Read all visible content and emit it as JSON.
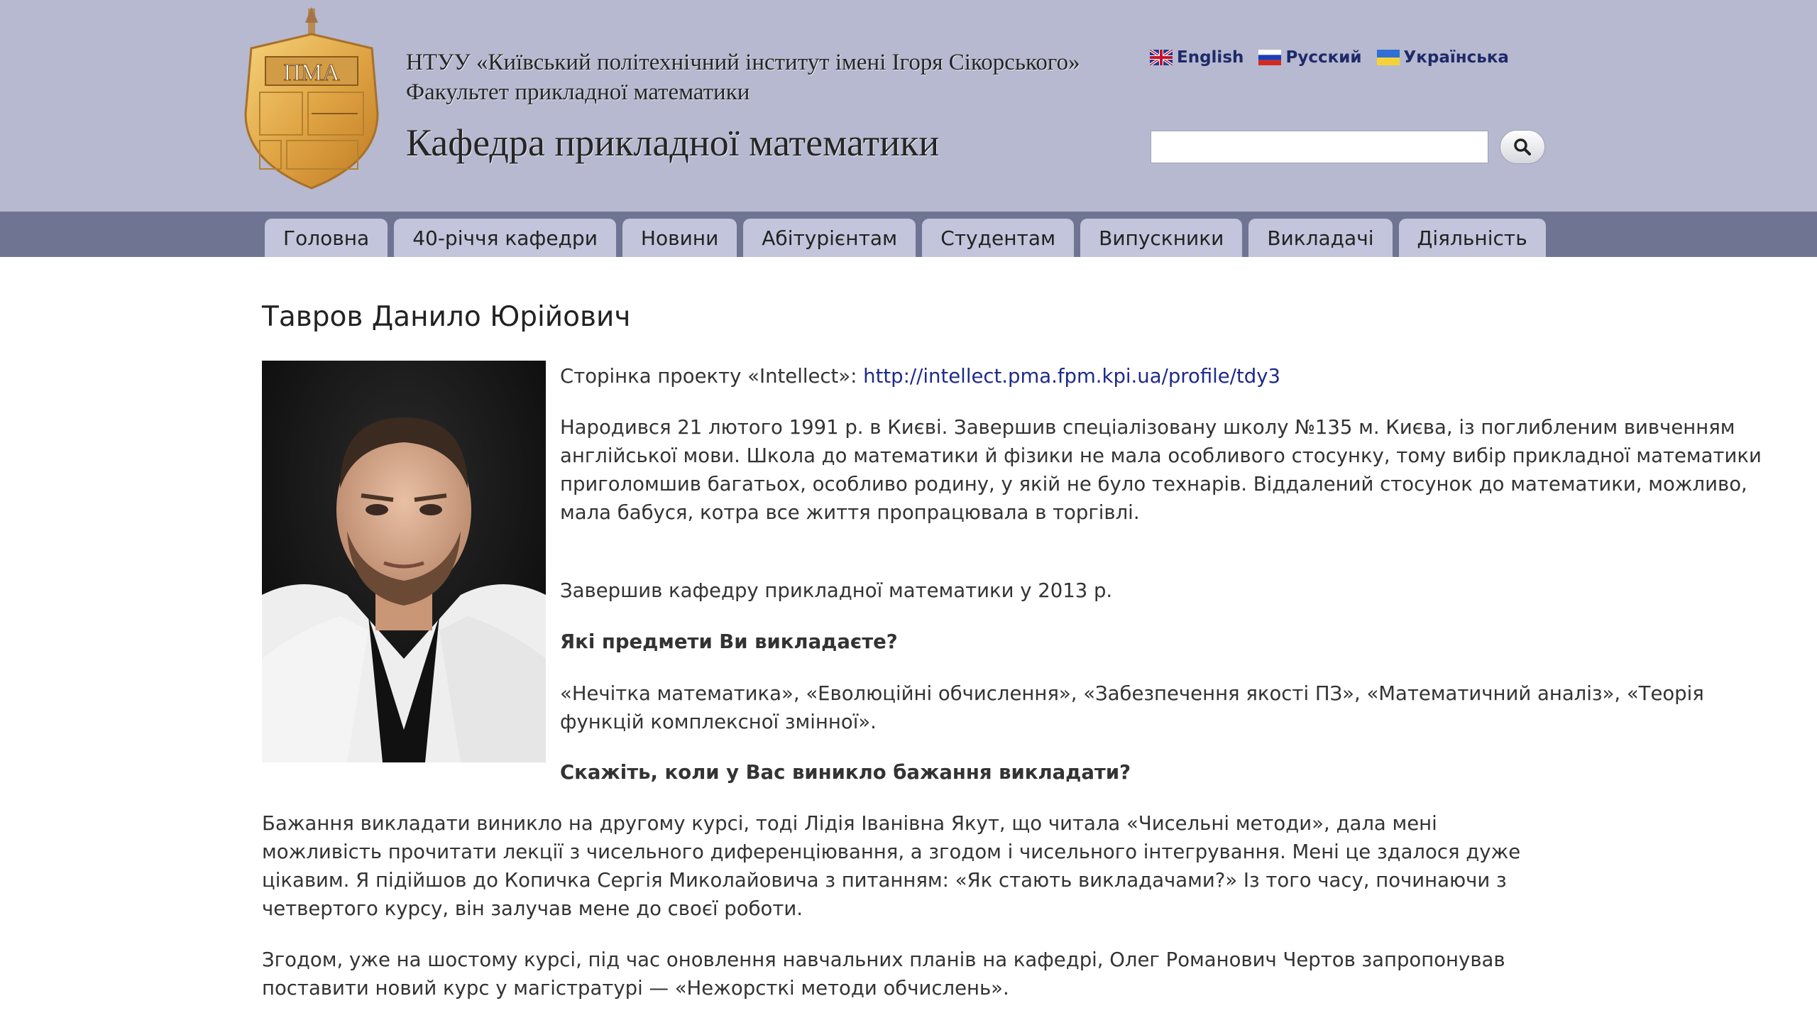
{
  "header": {
    "university": "НТУУ «Київський політехнічний інститут імені Ігоря Сікорського»",
    "faculty": "Факультет прикладної математики",
    "department": "Кафедра прикладної математики",
    "logo": {
      "abbrev": "ПМА",
      "icon": "department-crest-icon"
    },
    "languages": [
      {
        "label": "English",
        "icon": "uk-flag-icon"
      },
      {
        "label": "Русский",
        "icon": "ru-flag-icon"
      },
      {
        "label": "Українська",
        "icon": "ua-flag-icon"
      }
    ],
    "search": {
      "value": "",
      "placeholder": "",
      "icon": "search-icon"
    }
  },
  "nav": {
    "tabs": [
      {
        "label": "Головна"
      },
      {
        "label": "40-річчя кафедри"
      },
      {
        "label": "Новини"
      },
      {
        "label": "Абітурієнтам"
      },
      {
        "label": "Студентам"
      },
      {
        "label": "Випускники"
      },
      {
        "label": "Викладачі"
      },
      {
        "label": "Діяльність"
      }
    ]
  },
  "page": {
    "title": "Тавров Данило Юрійович",
    "intellect_prefix": "Сторінка проекту «Intellect»: ",
    "intellect_link": "http://intellect.pma.fpm.kpi.ua/profile/tdy3",
    "bio_1": "Народився 21 лютого 1991 р. в Києві. Завершив спеціалізовану школу №135 м. Києва, із поглибленим вивченням англійської мови. Школа до математики й фізики не мала особливого стосунку, тому вибір прикладної математики приголомшив багатьох, особливо родину, у якій не було технарів. Віддалений стосунок до математики, можливо, мала бабуся, котра все життя пропрацювала в торгівлі.",
    "bio_2": "Завершив кафедру прикладної математики у 2013 р.",
    "q1": "Які предмети Ви викладаєте?",
    "a1": "«Нечітка математика», «Еволюційні обчислення», «Забезпечення якості ПЗ», «Математичний аналіз», «Теорія функцій комплексної змінної».",
    "q2": "Скажіть, коли у Вас виникло бажання викладати?",
    "a2": "Бажання викладати виникло на другому курсі, тоді Лідія Іванівна Якут, що читала «Чисельні методи», дала мені можливість прочитати лекції з чисельного диференціювання, а згодом і чисельного інтегрування. Мені це здалося дуже цікавим. Я підійшов до Копичка Сергія Миколайовича з питанням: «Як стають викладачами?» Із того часу, починаючи з четвертого курсу, він залучав мене до своєї роботи.",
    "a3": "Згодом, уже на шостому курсі, під час оновлення навчальних планів на кафедрі, Олег Романович Чертов запропонував поставити новий курс у магістратурі — «Нежорсткі методи обчислень»."
  },
  "colors": {
    "header_bg": "#b6b9cf",
    "nav_bg": "#6f7493",
    "tab_bg": "#c2c5db",
    "link": "#1f2a8a"
  }
}
